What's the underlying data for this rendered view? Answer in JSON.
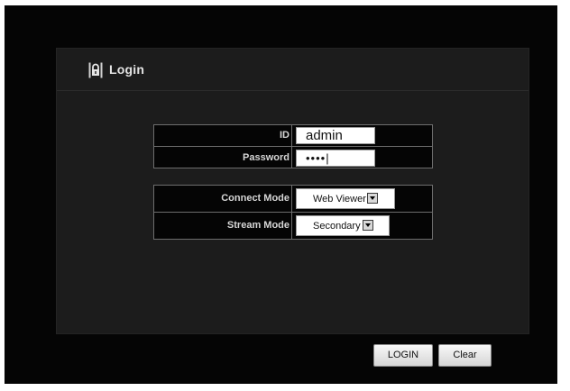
{
  "header": {
    "title": "Login",
    "icon": "lock-icon"
  },
  "form": {
    "id_label": "ID",
    "id_value": "admin",
    "password_label": "Password",
    "password_value": "••••|",
    "connect_mode_label": "Connect Mode",
    "connect_mode_value": "Web Viewer",
    "stream_mode_label": "Stream Mode",
    "stream_mode_value": "Secondary"
  },
  "buttons": {
    "login_label": "LOGIN",
    "clear_label": "Clear"
  },
  "colors": {
    "background": "#050505",
    "panel": "#1c1c1c",
    "border": "#6e6e6e"
  }
}
